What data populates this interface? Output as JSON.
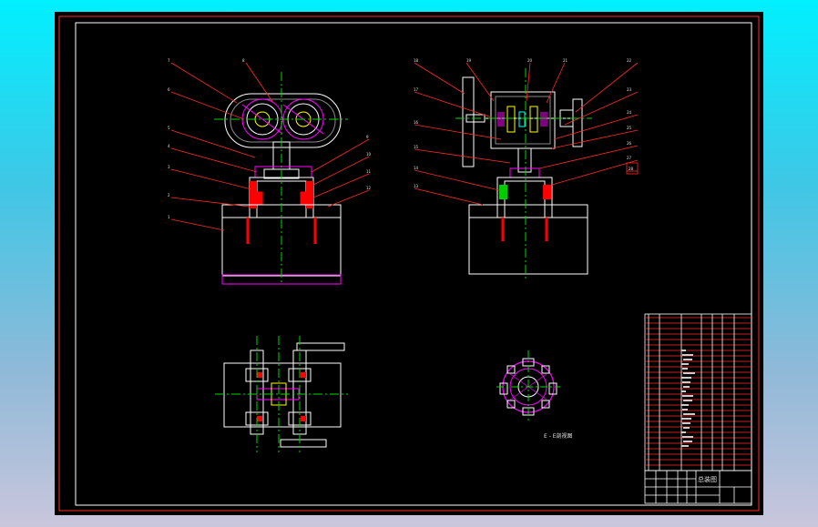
{
  "drawing": {
    "view_label": "E - E剖视图",
    "title_block": {
      "drawing_name": "总装图"
    },
    "colors": {
      "background": "#000000",
      "outline": "#ffffff",
      "frame": "#ff2a2a",
      "center_line": "#00d800",
      "hatch": "#ff0000",
      "highlight": "#ff00ff",
      "accent_cyan": "#00ffff",
      "accent_yellow": "#ffff00"
    },
    "callouts_left": [
      "7",
      "8",
      "6",
      "5",
      "4",
      "3",
      "2",
      "1",
      "9",
      "10",
      "11",
      "12"
    ],
    "callouts_right": [
      "18",
      "19",
      "20",
      "21",
      "22",
      "17",
      "16",
      "15",
      "14",
      "13",
      "23",
      "24",
      "25",
      "26",
      "27",
      "28"
    ]
  }
}
